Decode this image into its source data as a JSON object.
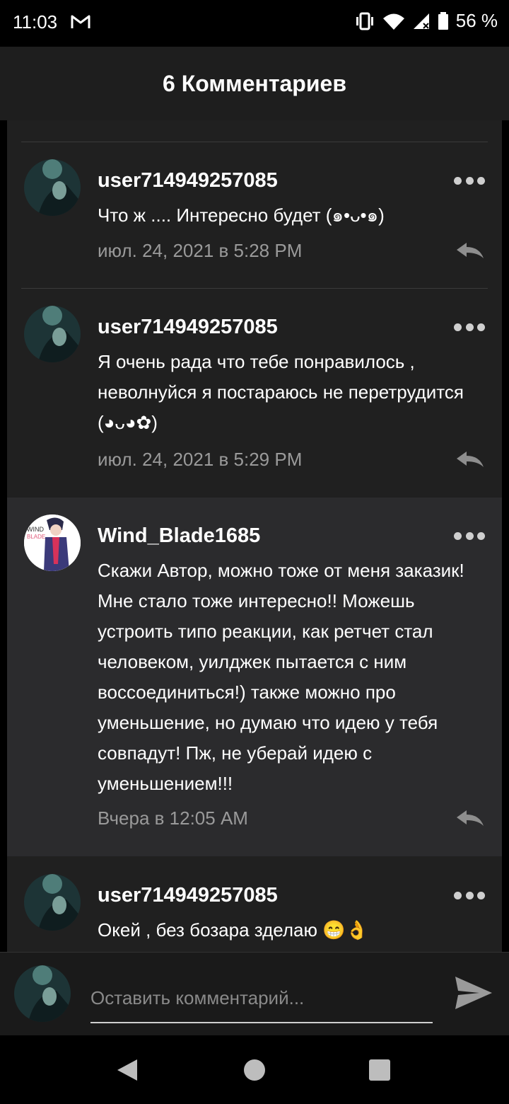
{
  "status": {
    "time": "11:03",
    "battery": "56 %"
  },
  "header": {
    "title": "6 Комментариев"
  },
  "comments": [
    {
      "user": "user714949257085",
      "text": "Что ж .... Интересно будет (๑•ᴗ•๑)",
      "date": "июл. 24, 2021 в 5:28 PM"
    },
    {
      "user": "user714949257085",
      "text": "Я очень рада что тебе понравилось , неволнуйся я постараюсь не перетрудится (◕ᴗ◕✿)",
      "date": "июл. 24, 2021 в 5:29 PM"
    },
    {
      "user": "Wind_Blade1685",
      "text": "Скажи Автор, можно тоже от меня заказик! Мне стало тоже интересно!! Можешь устроить типо реакции, как ретчет стал человеком,  уилджек пытается с ним воссоединиться!) также можно про уменьшение, но думаю что идею у тебя совпадут! Пж, не уберай идею с уменьшением!!!",
      "date": "Вчера в 12:05 AM",
      "avatar_text_1": "WIND",
      "avatar_text_2": "BLADE"
    },
    {
      "user": "user714949257085",
      "text": "Окей , без бозара зделаю 😁👌",
      "date": ""
    }
  ],
  "input": {
    "placeholder": "Оставить комментарий..."
  },
  "icons": {
    "more": "more-dots-icon",
    "reply": "reply-icon",
    "send": "send-icon",
    "back": "back-triangle-icon",
    "home": "home-circle-icon",
    "recent": "recent-square-icon"
  }
}
